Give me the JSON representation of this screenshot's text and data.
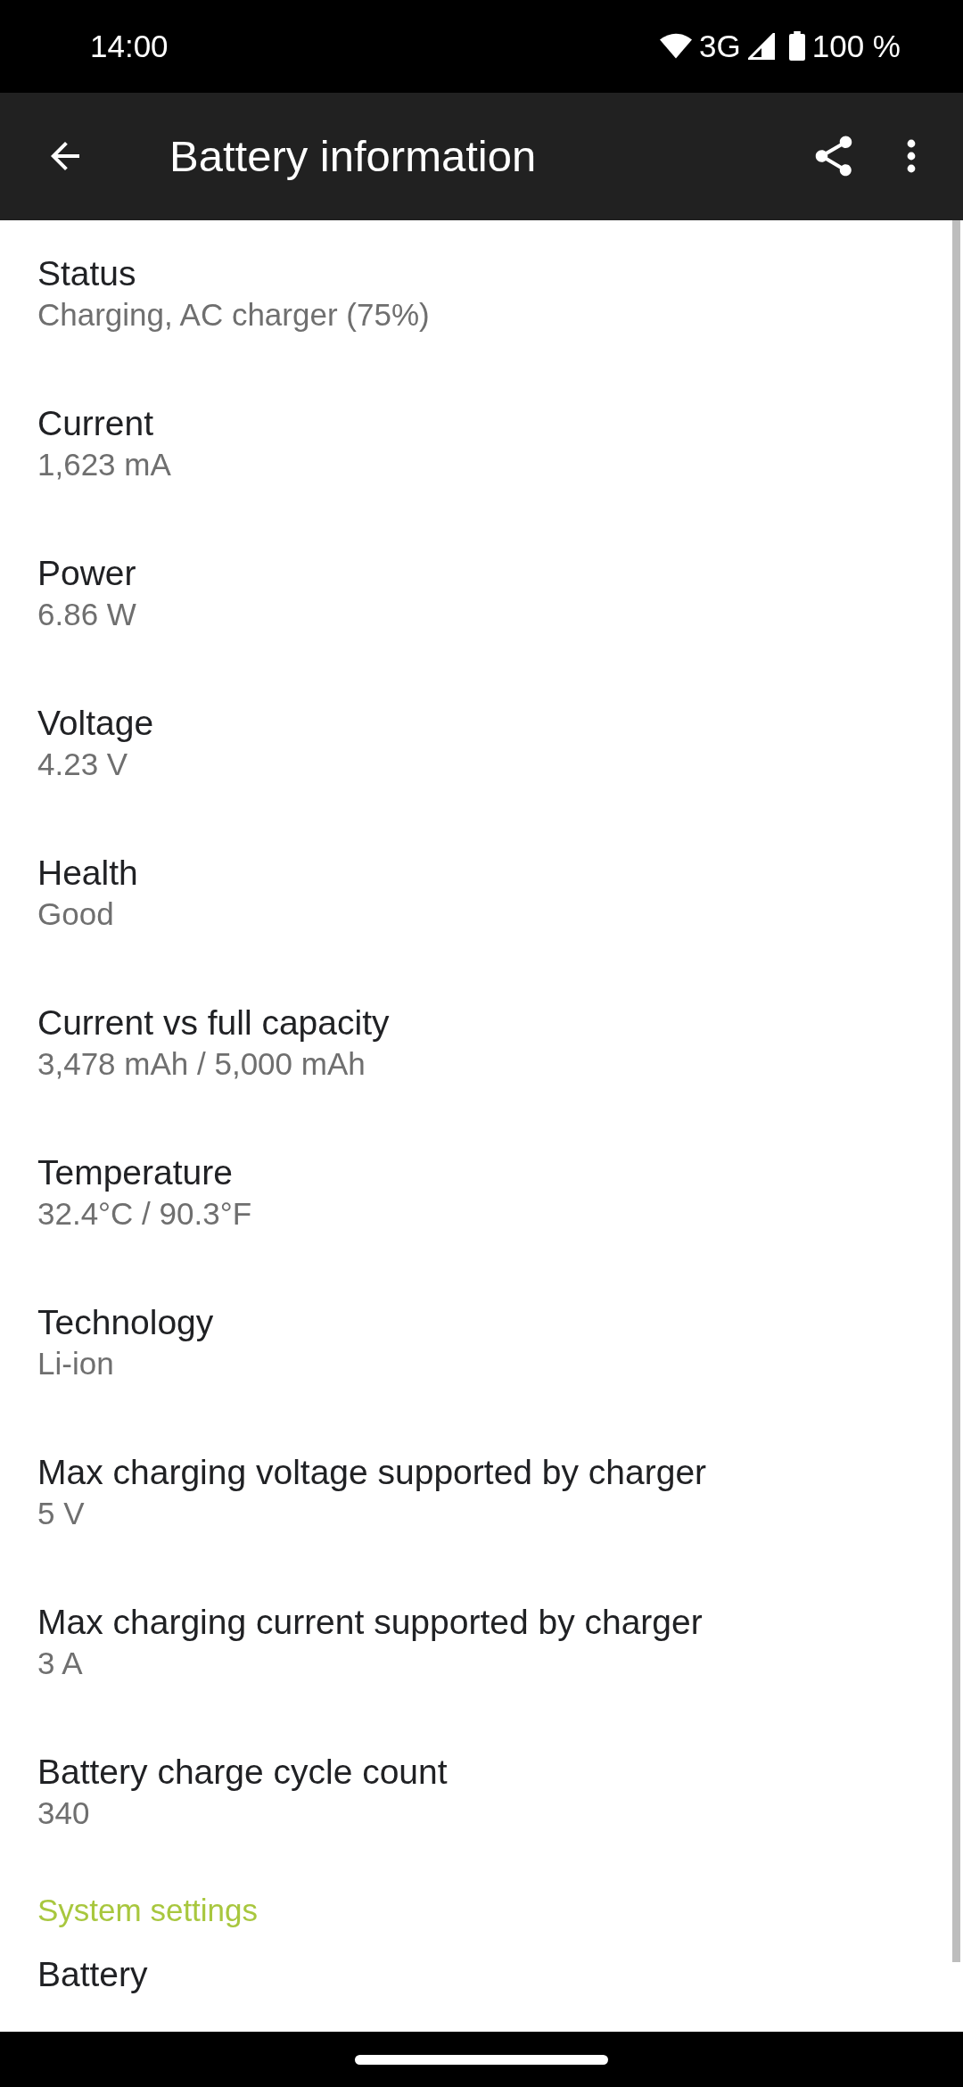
{
  "status_bar": {
    "time": "14:00",
    "network": "3G",
    "battery": "100 %"
  },
  "toolbar": {
    "title": "Battery information"
  },
  "items": [
    {
      "title": "Status",
      "value": "Charging, AC charger (75%)"
    },
    {
      "title": "Current",
      "value": "1,623 mA"
    },
    {
      "title": "Power",
      "value": "6.86 W"
    },
    {
      "title": "Voltage",
      "value": "4.23 V"
    },
    {
      "title": "Health",
      "value": "Good"
    },
    {
      "title": "Current vs full capacity",
      "value": "3,478 mAh / 5,000 mAh"
    },
    {
      "title": "Temperature",
      "value": "32.4°C / 90.3°F"
    },
    {
      "title": "Technology",
      "value": "Li-ion"
    },
    {
      "title": "Max charging voltage supported by charger",
      "value": "5 V"
    },
    {
      "title": "Max charging current supported by charger",
      "value": "3 A"
    },
    {
      "title": "Battery charge cycle count",
      "value": "340"
    }
  ],
  "section": {
    "header": "System settings",
    "items": [
      {
        "title": "Battery"
      }
    ]
  }
}
